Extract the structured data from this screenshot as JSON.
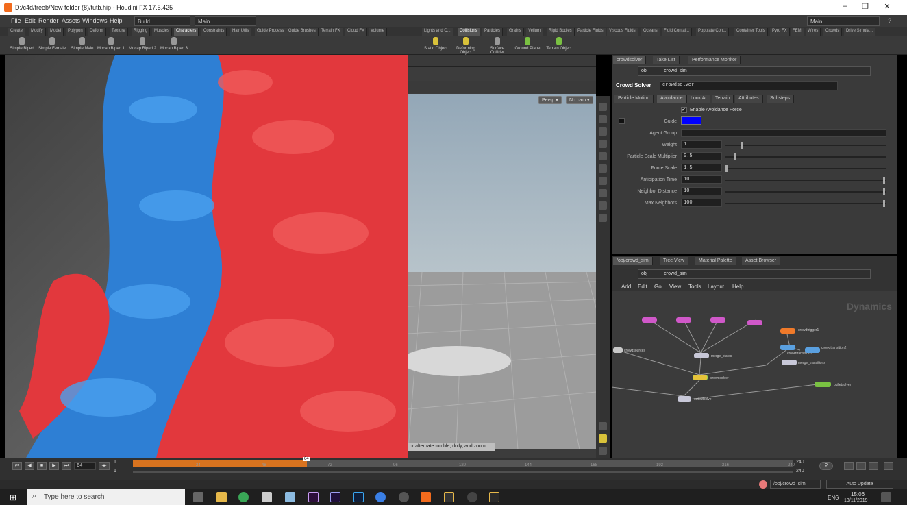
{
  "titlebar": {
    "title": "D:/c4d/freeb/New folder (8)/tutb.hip - Houdini FX 17.5.425"
  },
  "menubar": {
    "items": [
      "File",
      "Edit",
      "Render",
      "Assets",
      "Windows",
      "Help"
    ],
    "desktop": "Build",
    "context": "Main",
    "right_context": "Main"
  },
  "shelf_tabs_left": [
    "Create",
    "Modify",
    "Model",
    "Polygon",
    "Deform",
    "Texture",
    "Rigging",
    "Muscles",
    "Characters",
    "Constraints",
    "Hair Utils",
    "Guide Process",
    "Guide Brushes",
    "Terrain FX",
    "Cloud FX",
    "Volume"
  ],
  "shelf_tabs_right": [
    "Lights and C...",
    "Collisions",
    "Particles",
    "Grains",
    "Vellum",
    "Rigid Bodies",
    "Particle Fluids",
    "Viscous Fluids",
    "Oceans",
    "Fluid Contai...",
    "Populate Con...",
    "Container Tools",
    "Pyro FX",
    "FEM",
    "Wires",
    "Crowds",
    "Drive Simula..."
  ],
  "shelf_tools_left": [
    "Simple Biped",
    "Simple Female",
    "Simple Male",
    "Mocap Biped 1",
    "Mocap Biped 2",
    "Mocap Biped 3"
  ],
  "shelf_tools_right": [
    "Static Object",
    "Deforming Object",
    "Surface Collider",
    "Ground Plane",
    "Terrain Object"
  ],
  "viewport": {
    "persp": "Persp ▾",
    "cam": "No cam ▾",
    "hint": "or alternate tumble, dolly, and zoom."
  },
  "param_panel": {
    "tabs": [
      "crowdsolver",
      "Take List",
      "Performance Monitor"
    ],
    "path_obj": "obj",
    "path_node": "crowd_sim",
    "node_type": "Crowd Solver",
    "node_name": "crowdsolver",
    "sub_tabs": [
      "Particle Motion",
      "Avoidance",
      "Look At",
      "Terrain",
      "Attributes",
      "Substeps"
    ],
    "enable_label": "Enable Avoidance Force",
    "guide_label": "Guide",
    "agent_group_label": "Agent Group",
    "params": [
      {
        "label": "Weight",
        "value": "1",
        "slider": 0.1
      },
      {
        "label": "Particle Scale Multiplier",
        "value": "0.5",
        "slider": 0.05
      },
      {
        "label": "Force Scale",
        "value": "1.5",
        "slider": 0.0
      },
      {
        "label": "Anticipation Time",
        "value": "10",
        "slider": 1.0
      },
      {
        "label": "Neighbor Distance",
        "value": "10",
        "slider": 1.0
      },
      {
        "label": "Max Neighbors",
        "value": "100",
        "slider": 1.0
      }
    ]
  },
  "network": {
    "tabs": [
      "/obj/crowd_sim",
      "Tree View",
      "Material Palette",
      "Asset Browser"
    ],
    "path_obj": "obj",
    "path_node": "crowd_sim",
    "menu": [
      "Add",
      "Edit",
      "Go",
      "View",
      "Tools",
      "Layout",
      "Help"
    ],
    "context_label": "Dynamics",
    "nodes": [
      "merge_states",
      "crowdsolver",
      "outputsolve",
      "crowdsources",
      "merge_transitions",
      "crowdtrigger1",
      "crowdtransition1",
      "crowdtransition2",
      "bulletsolver"
    ]
  },
  "timeline": {
    "frame": "64",
    "start": "1",
    "start2": "1",
    "ticks": [
      "24",
      "48",
      "64",
      "72",
      "96",
      "120",
      "144",
      "168",
      "192",
      "216",
      "240"
    ],
    "end": "240",
    "end2": "240",
    "current_fraction": 0.263
  },
  "statusbar": {
    "path": "/obj/crowd_sim",
    "update": "Auto Update"
  },
  "taskbar": {
    "search": "Type here to search",
    "lang": "ENG",
    "time": "15:06",
    "date": "13/11/2019"
  }
}
